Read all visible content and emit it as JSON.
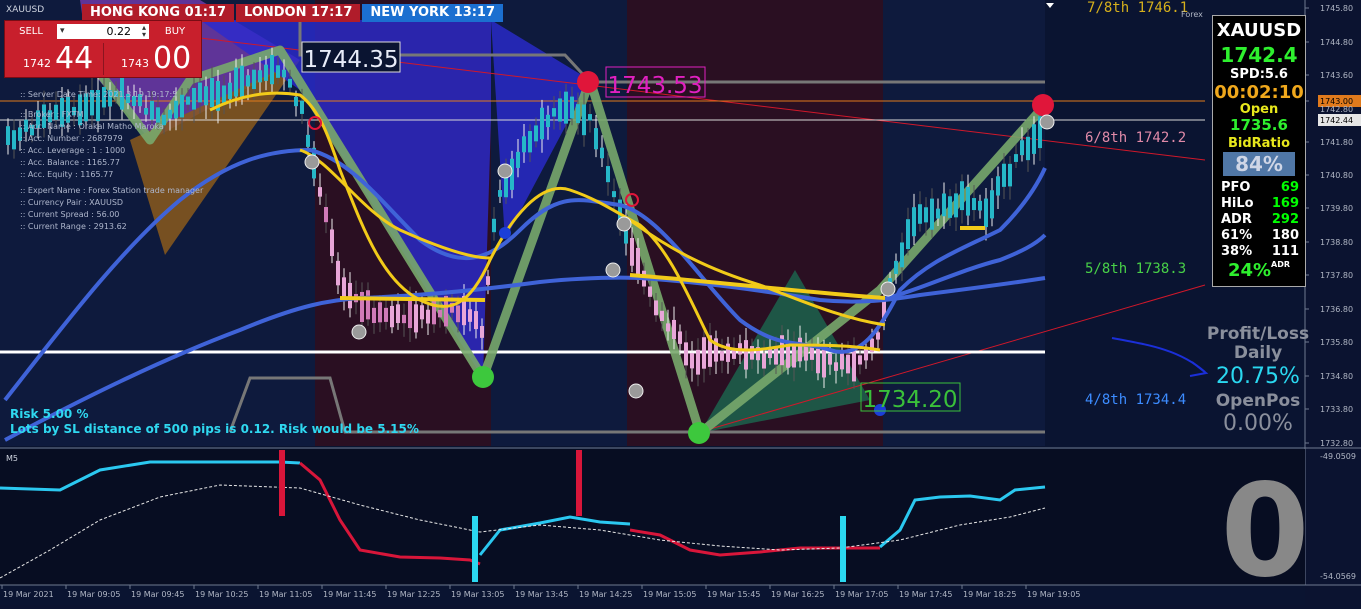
{
  "window": {
    "symbol_label": "XAUUSD",
    "timeframe_label": "M5"
  },
  "sessions": [
    {
      "label": "HONG KONG 01:17",
      "color": "#b01c2a"
    },
    {
      "label": "LONDON  17:17",
      "color": "#b01c2a"
    },
    {
      "label": "NEW YORK 13:17",
      "color": "#1b6fd0"
    }
  ],
  "trade_panel": {
    "sell_label": "SELL",
    "buy_label": "BUY",
    "lot_value": "0.22",
    "bid_prefix": "1742",
    "bid_big": "44",
    "ask_prefix": "1743",
    "ask_big": "00"
  },
  "account_info": {
    "lines": [
      ":: Server Date Time:  2021.3.19    19:17:5",
      "::  Broker              :  FXTM",
      "::  Acc. Name          :  Orakal Matho Maroka",
      "::  Acc. Number        :  2687979",
      "::  Acc. Leverage      :  1 : 1000",
      "::  Acc. Balance       :  1165.77",
      "::  Acc. Equity        :  1165.77",
      "::  Expert Name        :  Forex Station trade manager",
      "::  Currency Pair      :  XAUUSD",
      "::  Current Spread     :  56.00",
      "::  Current Range      :  2913.62"
    ]
  },
  "risk_text": {
    "line1": "Risk 5.00 %",
    "line2": "Lots by SL distance of 500 pips is 0.12. Risk would be 5.15%"
  },
  "price_labels": {
    "box1": "1744.35",
    "box2": "1743.53",
    "box3": "1734.20"
  },
  "murrey_levels": [
    {
      "label": "7/8th   1746.1",
      "color": "#d6b01c"
    },
    {
      "label": "6/8th   1742.2",
      "color": "#e08aa8"
    },
    {
      "label": "5/8th   1738.3",
      "color": "#48d048"
    },
    {
      "label": "4/8th   1734.4",
      "color": "#3c8cff"
    }
  ],
  "price_axis": {
    "ticks": [
      "1745.80",
      "1744.80",
      "1743.60",
      "1742.60",
      "1741.80",
      "1740.80",
      "1739.80",
      "1738.80",
      "1737.80",
      "1736.80",
      "1735.80",
      "1734.80",
      "1733.80",
      "1732.80"
    ],
    "tag_orange": "1743.00",
    "tag_white": "1742.44",
    "tag_below_orange": "1742.80",
    "corner_text": "Forex"
  },
  "oscillator_axis": {
    "top": "-49.0509",
    "bottom": "-54.0569"
  },
  "time_axis": [
    "19 Mar 2021",
    "19 Mar 09:05",
    "19 Mar 09:45",
    "19 Mar 10:25",
    "19 Mar 11:05",
    "19 Mar 11:45",
    "19 Mar 12:25",
    "19 Mar 13:05",
    "19 Mar 13:45",
    "19 Mar 14:25",
    "19 Mar 15:05",
    "19 Mar 15:45",
    "19 Mar 16:25",
    "19 Mar 17:05",
    "19 Mar 17:45",
    "19 Mar 18:25",
    "19 Mar 19:05"
  ],
  "info_box": {
    "symbol": "XAUUSD",
    "price": "1742.4",
    "spread": "SPD:5.6",
    "timer": "00:02:10",
    "open_label": "Open",
    "open_value": "1735.6",
    "bid_ratio_label": "BidRatio",
    "bid_ratio_value": "84%",
    "stats": [
      {
        "k": "PFO",
        "v": "69"
      },
      {
        "k": "HiLo",
        "v": "169"
      },
      {
        "k": "ADR",
        "v": "292"
      },
      {
        "k": "61%",
        "v": "180",
        "white": true
      },
      {
        "k": "38%",
        "v": "111",
        "white": true
      }
    ],
    "adr_pct": "24%",
    "adr_suffix": "ADR"
  },
  "profit_loss": {
    "title1": "Profit/Loss",
    "title2": "Daily",
    "daily_value": "20.75%",
    "open_label": "OpenPos",
    "open_value": "0.00%"
  },
  "big_digit": "0"
}
